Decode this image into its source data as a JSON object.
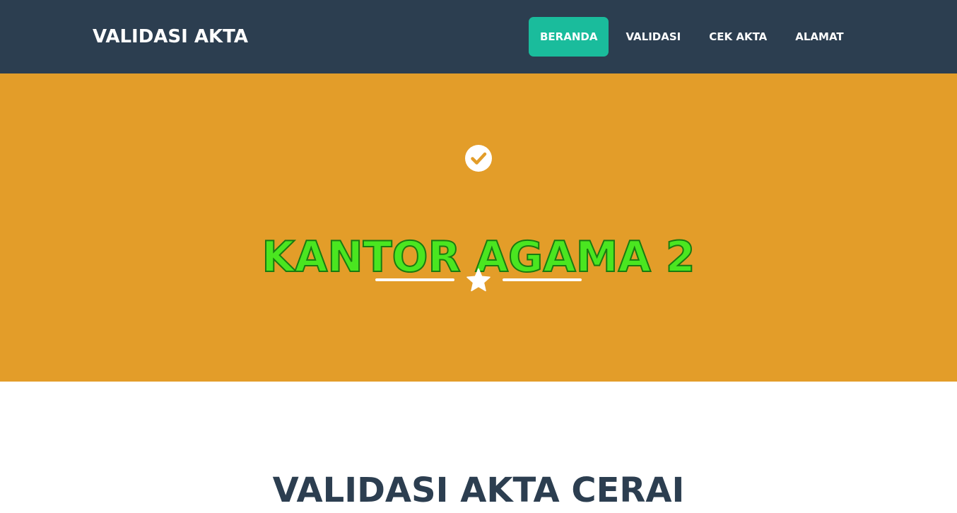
{
  "navbar": {
    "brand": "VALIDASI AKTA",
    "items": [
      {
        "label": "BERANDA",
        "active": true
      },
      {
        "label": "VALIDASI",
        "active": false
      },
      {
        "label": "CEK AKTA",
        "active": false
      },
      {
        "label": "ALAMAT",
        "active": false
      }
    ]
  },
  "masthead": {
    "icon": "check-circle-icon",
    "title": "KANTOR AGAMA 2",
    "divider_icon": "star-icon"
  },
  "section": {
    "heading": "VALIDASI AKTA CERAI"
  },
  "colors": {
    "navbar_bg": "#2c3e50",
    "active_nav_bg": "#1abc9c",
    "masthead_bg": "#e39d29",
    "title_color": "#4ae620",
    "heading_color": "#2c3e50"
  }
}
